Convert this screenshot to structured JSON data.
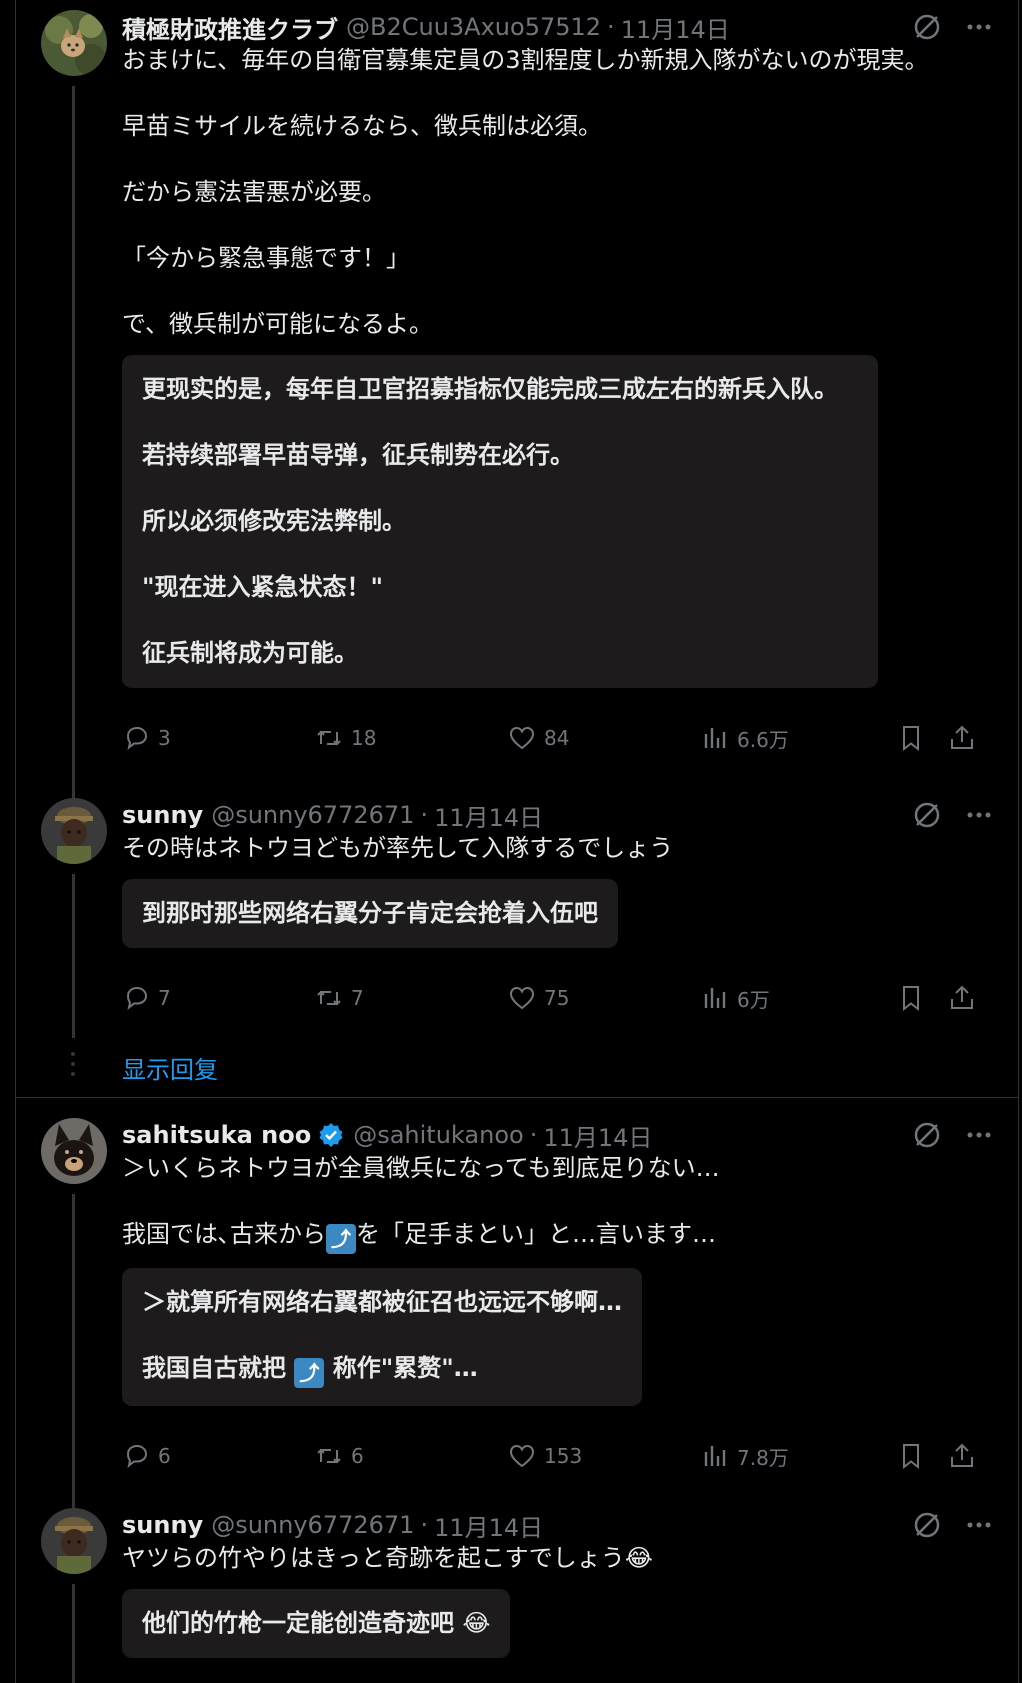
{
  "colors": {
    "background": "#000000",
    "text": "#e7e9ea",
    "muted": "#71767b",
    "link": "#1d9bf0",
    "translation_bg": "#1e1b1c",
    "verified": "#1d9bf0"
  },
  "icons": {
    "reply": "reply-icon",
    "retweet": "retweet-icon",
    "like": "heart-icon",
    "views": "views-icon",
    "bookmark": "bookmark-icon",
    "share": "share-icon",
    "grok": "grok-icon",
    "more": "more-icon"
  },
  "posts": [
    {
      "name": "積極財政推進クラブ",
      "handle": "@B2Cuu3Axuo57512",
      "date": "11月14日",
      "lines": [
        "おまけに、毎年の自衛官募集定員の3割程度しか新規入隊がないのが現実。",
        "早苗ミサイルを続けるなら、徴兵制は必須。",
        "だから憲法害悪が必要。",
        "「今から緊急事態です！」",
        "で、徴兵制が可能になるよ。"
      ],
      "translation": [
        "更现实的是，每年自卫官招募指标仅能完成三成左右的新兵入队。",
        "若持续部署早苗导弹，征兵制势在必行。",
        "所以必须修改宪法弊制。",
        "\"现在进入紧急状态！\"",
        "征兵制将成为可能。"
      ],
      "replies": "3",
      "retweets": "18",
      "likes": "84",
      "views": "6.6万"
    },
    {
      "name": "sunny",
      "handle": "@sunny6772671",
      "date": "11月14日",
      "lines": [
        "その時はネトウヨどもが率先して入隊するでしょう"
      ],
      "translation": [
        "到那时那些网络右翼分子肯定会抢着入伍吧"
      ],
      "replies": "7",
      "retweets": "7",
      "likes": "75",
      "views": "6万"
    },
    {
      "name": "sahitsuka noo",
      "handle": "@sahitukanoo",
      "date": "11月14日",
      "line1": "＞いくらネトウヨが全員徴兵になっても到底足りない…",
      "line2a": "我国では､古来から",
      "line2b": "を「足手まとい」と…言います…",
      "trans1": "＞就算所有网络右翼都被征召也远远不够啊…",
      "trans2a": "我国自古就把",
      "trans2b": "称作\"累赘\"…",
      "replies": "6",
      "retweets": "6",
      "likes": "153",
      "views": "7.8万"
    },
    {
      "name": "sunny",
      "handle": "@sunny6772671",
      "date": "11月14日",
      "line1": "ヤツらの竹やりはきっと奇跡を起こすでしょう",
      "trans1": "他们的竹枪一定能创造奇迹吧"
    }
  ],
  "show_replies": "显示回复",
  "separator": "·",
  "arrow_emoji": "⤴",
  "emoji_face": "😂"
}
